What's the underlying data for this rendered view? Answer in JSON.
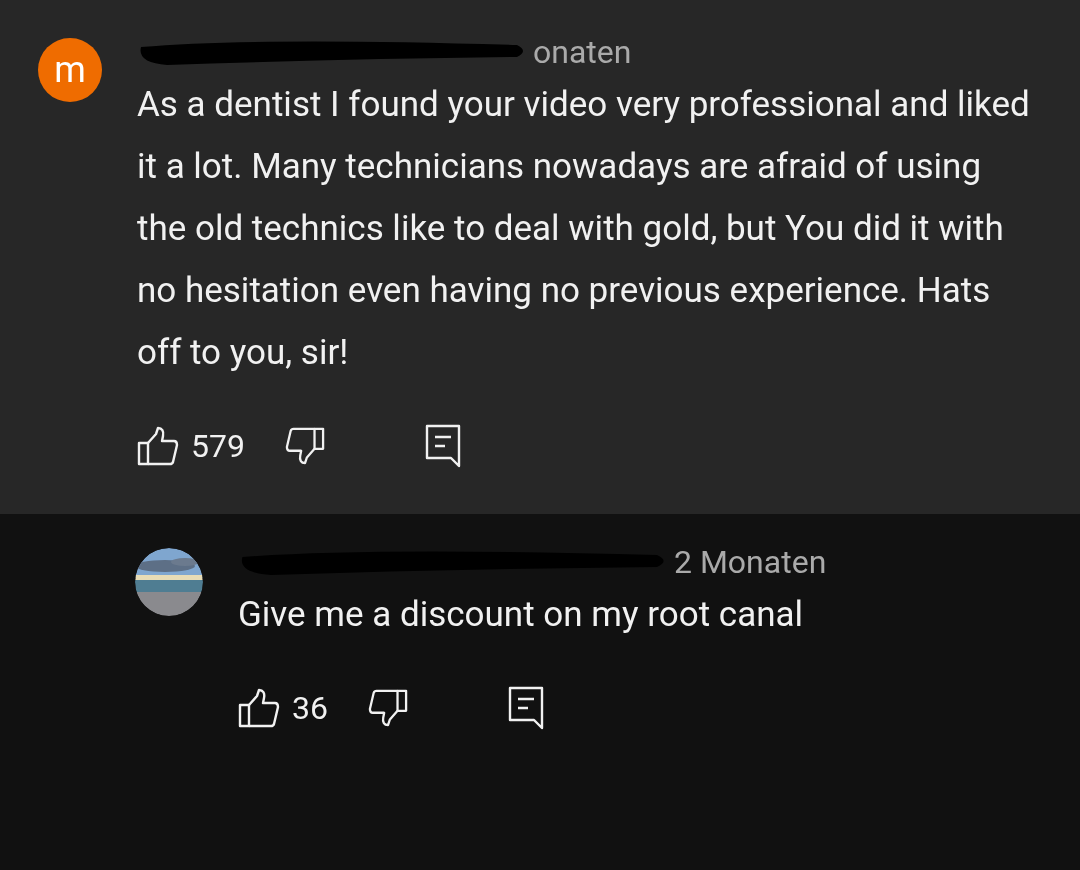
{
  "comments": [
    {
      "avatar": {
        "kind": "letter",
        "letter": "m",
        "color": "#ef6c00"
      },
      "meta": "onaten",
      "text": "As a dentist I found your video very professional and liked it a lot. Many technicians nowadays are afraid of using the old technics like to deal with gold, but You did it with no hesitation even having no previous experience. Hats off to you, sir!",
      "likes": "579"
    },
    {
      "meta": "2 Monaten",
      "text": "Give me a discount on my root canal",
      "likes": "36"
    }
  ]
}
